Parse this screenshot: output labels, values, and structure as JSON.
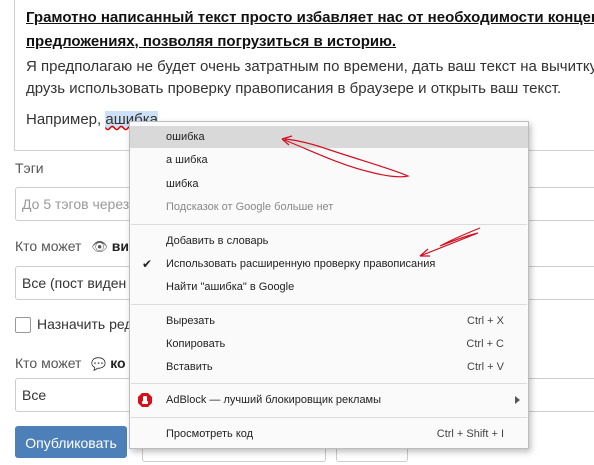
{
  "editor": {
    "heading": "Грамотно написанный текст просто избавляет нас от необходимости концент предложениях, позволяя погрузиться в историю.",
    "paragraph": "Я предполагаю не будет очень затратным по времени, дать ваш текст на вычитку друзь использовать проверку правописания в браузере и открыть ваш текст.",
    "example_prefix": "Например, ",
    "example_word": "ашибка"
  },
  "form": {
    "tags_label": "Тэги",
    "tags_placeholder": "До 5 тэгов через",
    "who_can_view_label": "Кто может",
    "who_can_view_bold": "ви",
    "visibility_value": "Все (пост виден",
    "assign_editor_label": "Назначить ред",
    "who_can_comment_label": "Кто может",
    "who_can_comment_bold": "ко",
    "comment_value": "Все",
    "publish_label": "Опубликовать"
  },
  "context_menu": {
    "suggestions": [
      "ошибка",
      "а шибка",
      "шибка"
    ],
    "no_more": "Подсказок от Google больше нет",
    "add_to_dictionary": "Добавить в словарь",
    "enhanced_spellcheck": "Использовать расширенную проверку правописания",
    "enhanced_checkmark": "✔",
    "search_google": "Найти \"ашибка\" в Google",
    "cut": "Вырезать",
    "cut_shortcut": "Ctrl + X",
    "copy": "Копировать",
    "copy_shortcut": "Ctrl + C",
    "paste": "Вставить",
    "paste_shortcut": "Ctrl + V",
    "adblock": "AdBlock — лучший блокировщик рекламы",
    "inspect": "Просмотреть код",
    "inspect_shortcut": "Ctrl + Shift + I"
  },
  "colors": {
    "publish_button": "#4d7fb8",
    "annotation": "#d01020",
    "adblock": "#d6101a",
    "highlight": "#d9d9d9"
  },
  "icons": [
    "eye-icon",
    "comment-icon",
    "checkmark-icon",
    "adblock-icon",
    "submenu-arrow-icon"
  ]
}
